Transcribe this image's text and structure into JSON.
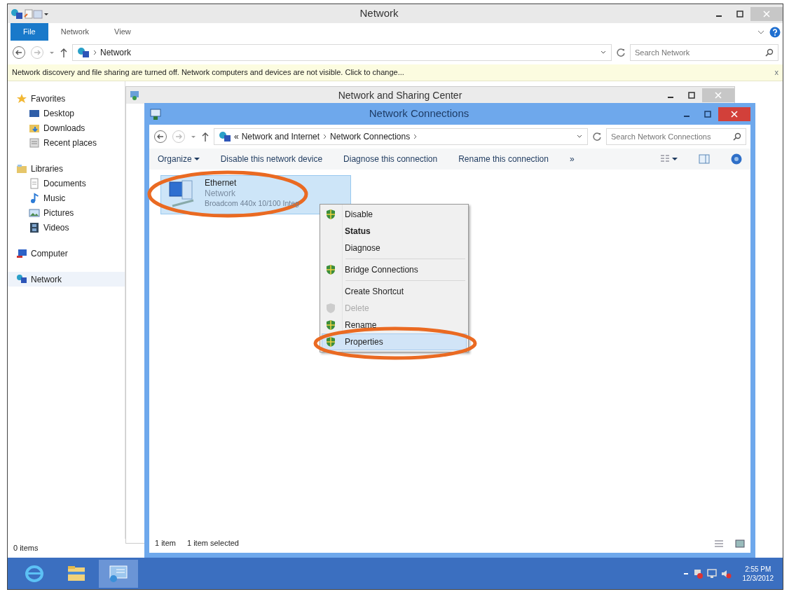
{
  "explorer": {
    "title": "Network",
    "ribbon_tabs": [
      {
        "label": "File",
        "selected": true
      },
      {
        "label": "Network",
        "selected": false
      },
      {
        "label": "View",
        "selected": false
      }
    ],
    "address": "Network",
    "search": {
      "placeholder": "Search Network"
    },
    "info_bar": {
      "text": "Network discovery and file sharing are turned off. Network computers and devices are not visible. Click to change...",
      "close": "x"
    },
    "nav": [
      {
        "label": "Favorites",
        "kind": "star",
        "selected": false,
        "children": [
          {
            "label": "Desktop",
            "kind": "desktop",
            "selected": false
          },
          {
            "label": "Downloads",
            "kind": "downloads",
            "selected": false
          },
          {
            "label": "Recent places",
            "kind": "recent",
            "selected": false
          }
        ]
      },
      {
        "label": "Libraries",
        "kind": "libraries",
        "selected": false,
        "children": [
          {
            "label": "Documents",
            "kind": "documents",
            "selected": false
          },
          {
            "label": "Music",
            "kind": "music",
            "selected": false
          },
          {
            "label": "Pictures",
            "kind": "pictures",
            "selected": false
          },
          {
            "label": "Videos",
            "kind": "videos",
            "selected": false
          }
        ]
      },
      {
        "label": "Computer",
        "kind": "computer",
        "selected": false
      },
      {
        "label": "Network",
        "kind": "network",
        "selected": true
      }
    ],
    "status": "0 items"
  },
  "sharing_center": {
    "title": "Network and Sharing Center"
  },
  "connections": {
    "title": "Network Connections",
    "breadcrumb_lead": "«",
    "breadcrumb": [
      "Network and Internet",
      "Network Connections"
    ],
    "search": {
      "placeholder": "Search Network Connections"
    },
    "toolbar": [
      {
        "label": "Organize",
        "dropdown": true
      },
      {
        "label": "Disable this network device",
        "dropdown": false
      },
      {
        "label": "Diagnose this connection",
        "dropdown": false
      },
      {
        "label": "Rename this connection",
        "dropdown": false
      }
    ],
    "more": "»",
    "items": [
      {
        "name": "Ethernet",
        "status": "Network",
        "device": "Broadcom 440x 10/100 Integ",
        "selected": true,
        "circled": true
      }
    ],
    "status": [
      "1 item",
      "1 item selected"
    ]
  },
  "context_menu": [
    [
      {
        "label": "Disable",
        "shield": true,
        "bold": false,
        "disabled": false,
        "selected": false,
        "circled": false
      },
      {
        "label": "Status",
        "shield": false,
        "bold": true,
        "disabled": false,
        "selected": false,
        "circled": false
      },
      {
        "label": "Diagnose",
        "shield": false,
        "bold": false,
        "disabled": false,
        "selected": false,
        "circled": false
      }
    ],
    [
      {
        "label": "Bridge Connections",
        "shield": true,
        "bold": false,
        "disabled": false,
        "selected": false,
        "circled": false
      }
    ],
    [
      {
        "label": "Create Shortcut",
        "shield": false,
        "bold": false,
        "disabled": false,
        "selected": false,
        "circled": false
      },
      {
        "label": "Delete",
        "shield": true,
        "bold": false,
        "disabled": true,
        "selected": false,
        "circled": false
      },
      {
        "label": "Rename",
        "shield": true,
        "bold": false,
        "disabled": false,
        "selected": false,
        "circled": false
      },
      {
        "label": "Properties",
        "shield": true,
        "bold": false,
        "disabled": false,
        "selected": true,
        "circled": true
      }
    ]
  ],
  "taskbar": {
    "apps": [
      {
        "kind": "browser",
        "selected": false
      },
      {
        "kind": "folder",
        "selected": false
      },
      {
        "kind": "network",
        "selected": true
      }
    ],
    "time": "2:55 PM",
    "date": "12/3/2012"
  }
}
